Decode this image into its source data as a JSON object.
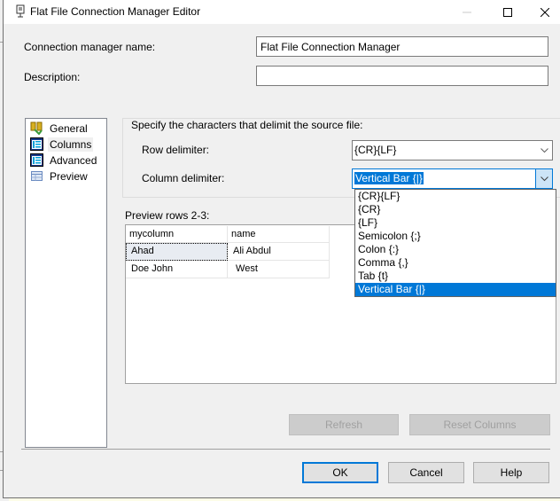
{
  "window": {
    "title": "Flat File Connection Manager Editor",
    "controls": {
      "minimize": "—",
      "maximize": "☐",
      "close": "✕"
    }
  },
  "form": {
    "name_label": "Connection manager name:",
    "name_value": "Flat File Connection Manager",
    "description_label": "Description:",
    "description_value": ""
  },
  "nav": {
    "items": [
      {
        "label": "General",
        "icon": "general-icon"
      },
      {
        "label": "Columns",
        "icon": "columns-icon",
        "selected": true
      },
      {
        "label": "Advanced",
        "icon": "advanced-icon"
      },
      {
        "label": "Preview",
        "icon": "preview-icon"
      }
    ]
  },
  "delimiters": {
    "group_title": "Specify the characters that delimit the source file:",
    "row_label": "Row delimiter:",
    "row_value": "{CR}{LF}",
    "column_label": "Column delimiter:",
    "column_value": "Vertical Bar {|}",
    "options": [
      "{CR}{LF}",
      "{CR}",
      "{LF}",
      "Semicolon {;}",
      "Colon {:}",
      "Comma {,}",
      "Tab {t}",
      "Vertical Bar {|}"
    ],
    "selected_index": 7
  },
  "preview": {
    "label": "Preview rows 2-3:",
    "columns": [
      "mycolumn",
      "name"
    ],
    "rows": [
      [
        "Ahad",
        "Ali Abdul"
      ],
      [
        "Doe John",
        " West"
      ]
    ]
  },
  "buttons": {
    "refresh": "Refresh",
    "reset_columns": "Reset Columns",
    "ok": "OK",
    "cancel": "Cancel",
    "help": "Help"
  },
  "colors": {
    "accent": "#0078d7",
    "dialog_bg": "#f0f0f0"
  }
}
